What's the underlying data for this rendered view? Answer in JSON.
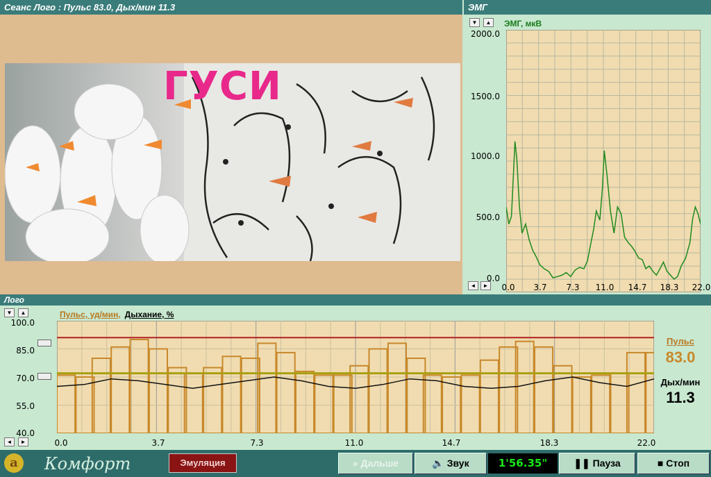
{
  "video_window": {
    "title": "Сеанс Лого : Пульс 83.0, Дых/мин 11.3",
    "image_word": "ГУСИ"
  },
  "emg_window": {
    "title": "ЭМГ",
    "channel_label": "ЭМГ, мкВ",
    "scroll_down_icon": "triangle-down-icon",
    "scroll_up_icon": "triangle-up-icon",
    "y_ticks": [
      "2000.0",
      "1500.0",
      "1000.0",
      "500.0",
      "0.0"
    ],
    "x_ticks": [
      "0.0",
      "3.7",
      "7.3",
      "11.0",
      "14.7",
      "18.3",
      "22.0"
    ]
  },
  "logo_window": {
    "title": "Лого",
    "legend_pulse": "Пульс, уд/мин,",
    "legend_breath": "Дыхание, %",
    "y_ticks": [
      "100.0",
      "85.0",
      "70.0",
      "55.0",
      "40.0"
    ],
    "x_ticks": [
      "0.0",
      "3.7",
      "7.3",
      "11.0",
      "14.7",
      "18.3",
      "22.0"
    ]
  },
  "readouts": {
    "pulse_label": "Пульс",
    "pulse_value": "83.0",
    "breath_label": "Дых/мин",
    "breath_value": "11.3"
  },
  "toolbar": {
    "brand": "Комфорт",
    "brand_logo_letter": "a",
    "emulation": "Эмуляция",
    "next": "Дальше",
    "next_icon": "double-chevron-right-icon",
    "sound": "Звук",
    "sound_icon": "speaker-icon",
    "timer": "1'56.35\"",
    "pause": "Пауза",
    "pause_icon": "pause-icon",
    "stop": "Стоп",
    "stop_icon": "stop-icon"
  },
  "colors": {
    "title_bar": "#3a7c7a",
    "panel_bg": "#c8e8d0",
    "plot_bg": "#f0dcb0",
    "pulse": "#c8882a",
    "emg_line": "#1f8a1f",
    "threshold_high": "#b02020",
    "threshold_low": "#a8a010",
    "accent_text": "#b87820"
  },
  "chart_data": [
    {
      "type": "line",
      "title": "ЭМГ, мкВ",
      "xlim": [
        0,
        22
      ],
      "ylim": [
        0,
        2000
      ],
      "grid": true,
      "series": [
        {
          "name": "ЭМГ, мкВ",
          "x": [
            0.0,
            0.3,
            0.6,
            1.0,
            1.2,
            1.5,
            1.8,
            2.2,
            2.6,
            3.0,
            3.4,
            3.8,
            4.3,
            4.8,
            5.3,
            5.8,
            6.3,
            6.8,
            7.3,
            7.8,
            8.3,
            8.8,
            9.2,
            9.6,
            9.9,
            10.2,
            10.6,
            10.9,
            11.1,
            11.4,
            11.8,
            12.2,
            12.6,
            13.0,
            13.4,
            13.8,
            14.2,
            14.6,
            15.0,
            15.4,
            15.8,
            16.2,
            16.6,
            17.0,
            17.4,
            17.8,
            18.2,
            18.6,
            19.0,
            19.4,
            19.8,
            20.3,
            20.8,
            21.1,
            21.4,
            21.7,
            22.0
          ],
          "y": [
            650,
            520,
            580,
            1150,
            1020,
            650,
            450,
            520,
            400,
            320,
            270,
            210,
            180,
            160,
            110,
            120,
            130,
            150,
            120,
            170,
            190,
            180,
            240,
            380,
            480,
            620,
            550,
            800,
            1080,
            900,
            620,
            450,
            650,
            600,
            420,
            380,
            350,
            310,
            260,
            250,
            180,
            200,
            160,
            130,
            180,
            230,
            160,
            130,
            100,
            120,
            200,
            260,
            380,
            560,
            650,
            600,
            520
          ]
        }
      ]
    },
    {
      "type": "bar",
      "title": "Пульс, уд/мин, Дыхание, %",
      "xlim": [
        0,
        22
      ],
      "ylim": [
        40,
        100
      ],
      "grid": true,
      "series": [
        {
          "name": "Пульс, уд/мин,",
          "x": [
            0.0,
            0.7,
            1.3,
            2.0,
            2.7,
            3.4,
            4.1,
            4.7,
            5.4,
            6.1,
            6.8,
            7.4,
            8.1,
            8.8,
            9.5,
            10.2,
            10.8,
            11.5,
            12.2,
            12.9,
            13.5,
            14.2,
            14.9,
            15.6,
            16.3,
            16.9,
            17.6,
            18.3,
            19.0,
            19.7,
            20.4,
            21.0,
            21.7
          ],
          "values": [
            71,
            70,
            80,
            86,
            90,
            85,
            75,
            72,
            75,
            81,
            80,
            88,
            83,
            73,
            71,
            71,
            76,
            85,
            88,
            80,
            71,
            70,
            71,
            79,
            86,
            89,
            86,
            76,
            70,
            71,
            72,
            83,
            83
          ]
        },
        {
          "name": "Дыхание, %",
          "x": [
            0.0,
            1.0,
            2.0,
            3.0,
            4.0,
            5.0,
            6.0,
            7.0,
            8.0,
            9.0,
            10.0,
            11.0,
            12.0,
            13.0,
            14.0,
            15.0,
            16.0,
            17.0,
            18.0,
            19.0,
            20.0,
            21.0,
            22.0
          ],
          "values": [
            65,
            66,
            69,
            68,
            66,
            64,
            66,
            68,
            70,
            68,
            65,
            64,
            66,
            69,
            68,
            65,
            64,
            65,
            68,
            70,
            67,
            65,
            69
          ]
        }
      ],
      "reference_lines": [
        91,
        72
      ]
    }
  ]
}
